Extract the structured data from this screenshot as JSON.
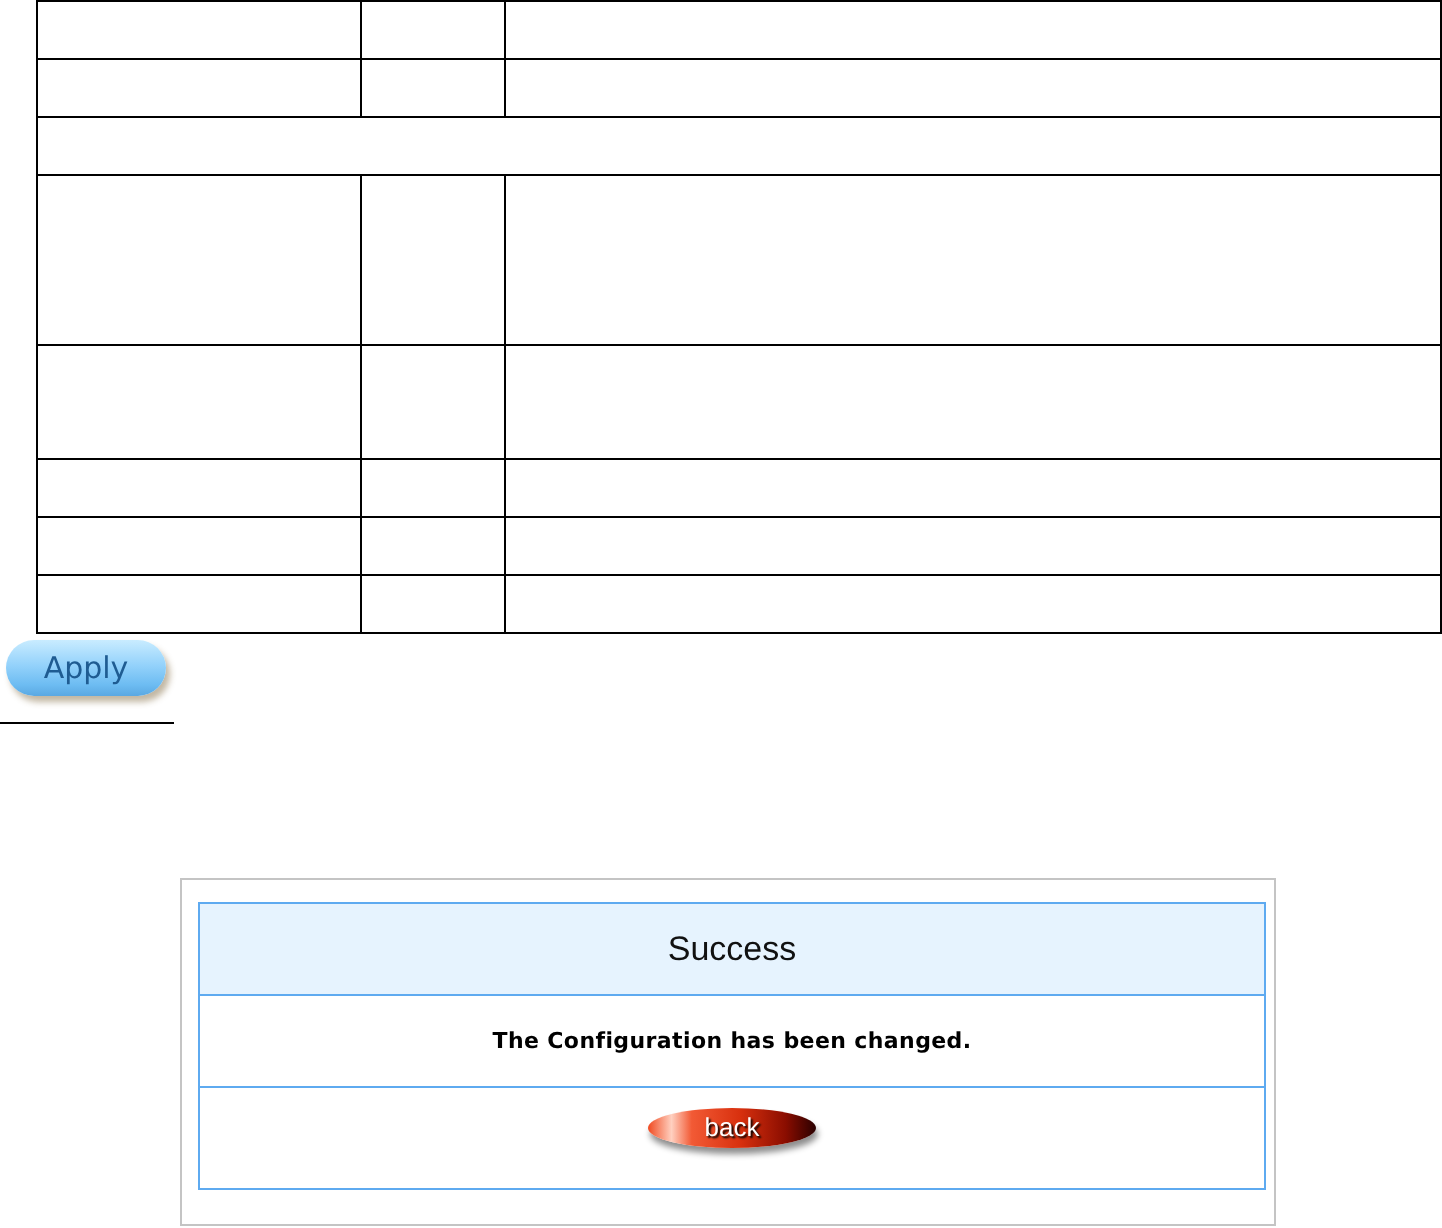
{
  "table": {
    "rows": [
      {
        "kind": "single"
      },
      {
        "kind": "single"
      },
      {
        "kind": "section"
      },
      {
        "kind": "triple"
      },
      {
        "kind": "double"
      },
      {
        "kind": "single"
      },
      {
        "kind": "single"
      },
      {
        "kind": "single"
      }
    ]
  },
  "apply_button": {
    "label": "Apply"
  },
  "dialog": {
    "title": "Success",
    "message": "The Configuration has been changed.",
    "button": "back"
  }
}
